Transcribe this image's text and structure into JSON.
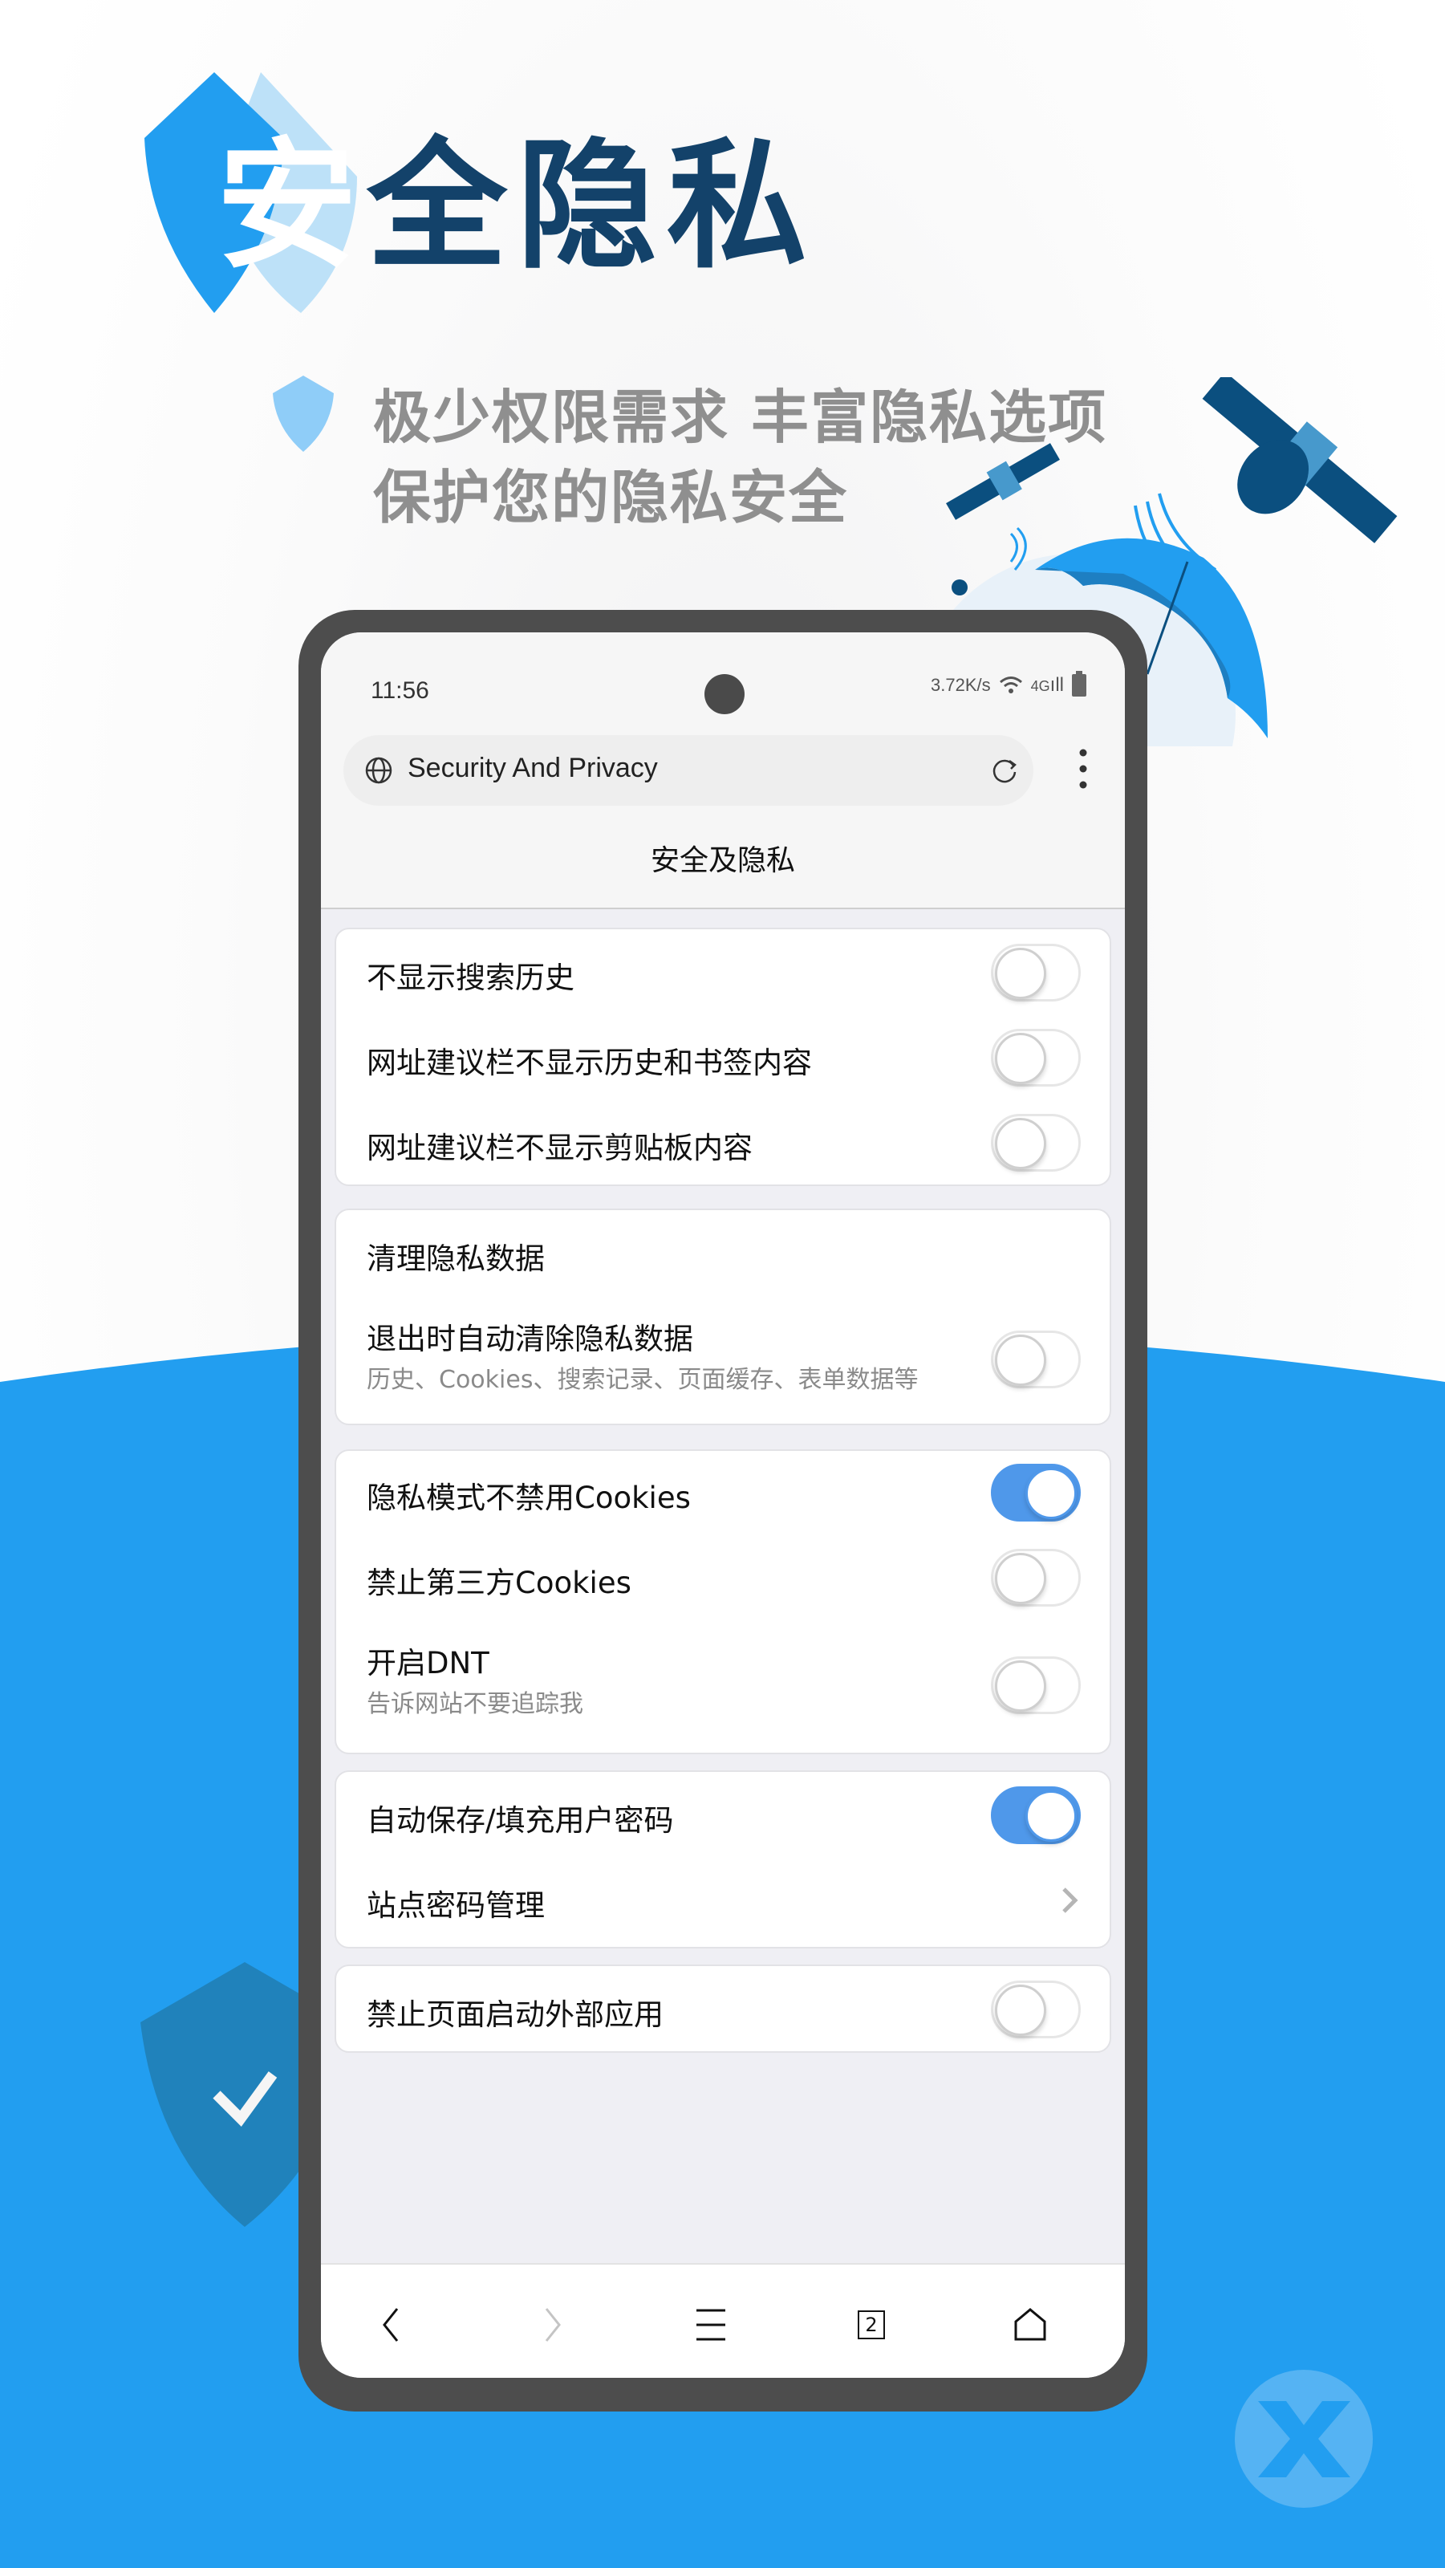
{
  "hero": {
    "title_first": "安",
    "title_rest": "全隐私",
    "subtitle_line1": "极少权限需求 丰富隐私选项",
    "subtitle_line2": "保护您的隐私安全"
  },
  "colors": {
    "brand_blue": "#229ef0",
    "title_navy": "#13426a",
    "toggle_on": "#4f98ea"
  },
  "status_bar": {
    "time": "11:56",
    "net_speed": "3.72K/s",
    "network": "4G"
  },
  "browser": {
    "url_text": "Security And Privacy",
    "page_title": "安全及隐私"
  },
  "settings": {
    "group1": [
      {
        "label": "不显示搜索历史",
        "toggle": false
      },
      {
        "label": "网址建议栏不显示历史和书签内容",
        "toggle": false
      },
      {
        "label": "网址建议栏不显示剪贴板内容",
        "toggle": false
      }
    ],
    "group2": {
      "header": "清理隐私数据",
      "item": {
        "label": "退出时自动清除隐私数据",
        "sub": "历史、Cookies、搜索记录、页面缓存、表单数据等",
        "toggle": false
      }
    },
    "group3": [
      {
        "label": "隐私模式不禁用Cookies",
        "toggle": true
      },
      {
        "label": "禁止第三方Cookies",
        "toggle": false
      },
      {
        "label": "开启DNT",
        "sub": "告诉网站不要追踪我",
        "toggle": false
      }
    ],
    "group4": [
      {
        "label": "自动保存/填充用户密码",
        "toggle": true
      },
      {
        "label": "站点密码管理"
      }
    ],
    "group5": [
      {
        "label": "禁止页面启动外部应用",
        "toggle": false
      }
    ]
  },
  "bottom_nav": {
    "tab_count": "2"
  }
}
